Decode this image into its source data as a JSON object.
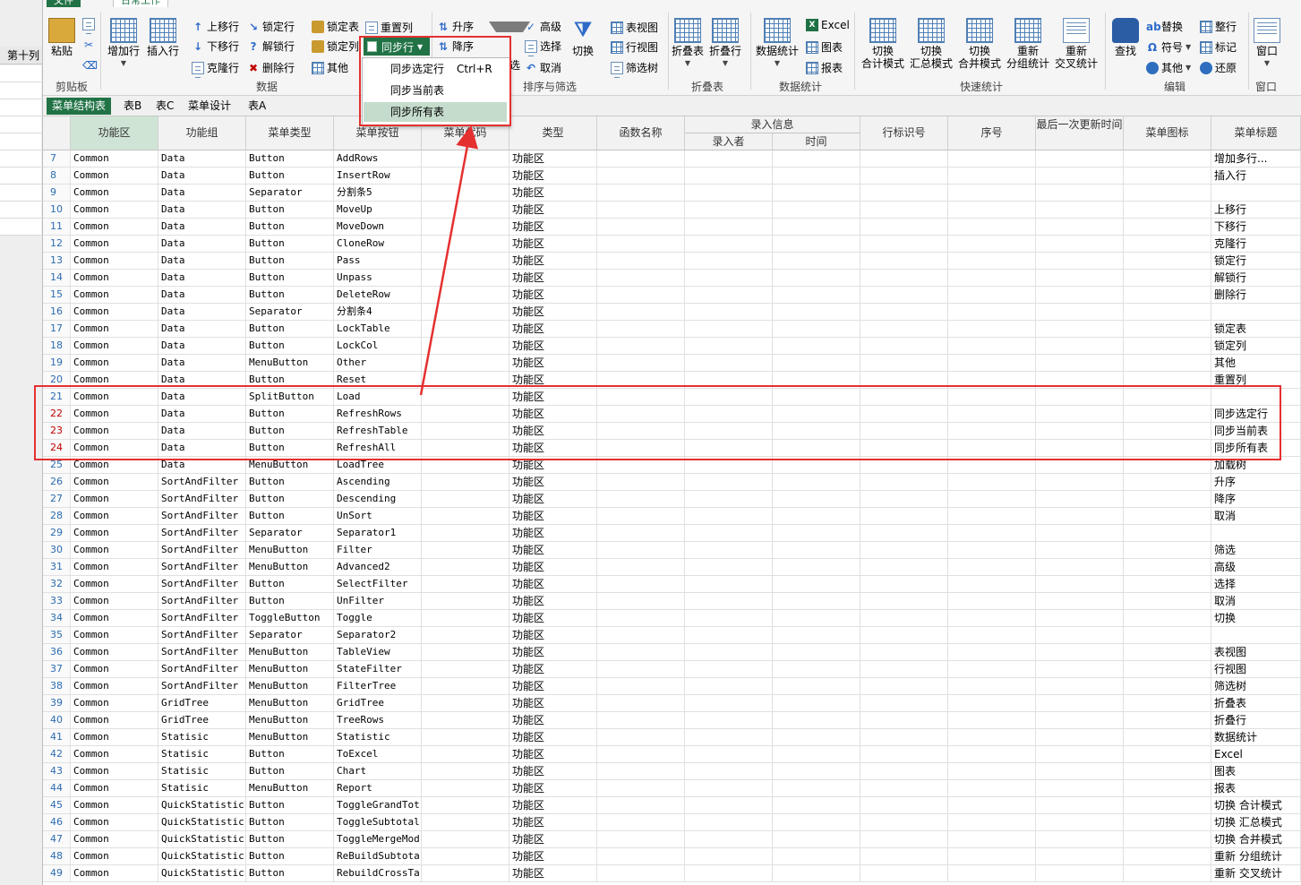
{
  "left_pane": {
    "col_header": "第十列"
  },
  "ribbon": {
    "tabs": [
      "文件",
      "日常工作",
      "",
      "",
      "",
      ""
    ],
    "groups": {
      "clipboard": {
        "label": "剪贴板",
        "paste": "粘贴"
      },
      "data": {
        "label": "数据",
        "add_row": "增加行",
        "insert_row": "插入行",
        "move_up": "上移行",
        "move_down": "下移行",
        "clone_row": "克隆行",
        "lock_row": "锁定行",
        "unlock_row": "解锁行",
        "delete_row": "删除行",
        "lock_table": "锁定表",
        "lock_col": "锁定列",
        "other": "其他",
        "reset_col": "重置列",
        "sync_row": "同步行"
      },
      "sort_filter": {
        "label": "排序与筛选",
        "asc": "升序",
        "desc": "降序",
        "filter": "筛选",
        "advanced": "高级",
        "select": "选择",
        "cancel": "取消",
        "toggle": "切换"
      },
      "view": {
        "table_view": "表视图",
        "row_view": "行视图",
        "filter_tree": "筛选树"
      },
      "fold": {
        "label": "折叠表",
        "fold_table": "折叠表",
        "fold_row": "折叠行"
      },
      "stats": {
        "label": "数据统计",
        "data_stats": "数据统计",
        "excel": "Excel",
        "chart": "图表",
        "report": "报表"
      },
      "quick": {
        "label": "快速统计",
        "items": [
          [
            "切换",
            "合计模式"
          ],
          [
            "切换",
            "汇总模式"
          ],
          [
            "切换",
            "合并模式"
          ],
          [
            "重新",
            "分组统计"
          ],
          [
            "重新",
            "交叉统计"
          ]
        ]
      },
      "edit": {
        "label": "编辑",
        "find": "查找",
        "replace": "替换",
        "symbol": "符号",
        "other": "其他",
        "tidy": "整行",
        "mark": "标记",
        "restore": "还原"
      },
      "window": {
        "label": "窗口",
        "window": "窗口"
      }
    }
  },
  "dropdown": {
    "items": [
      {
        "label": "同步选定行",
        "shortcut": "Ctrl+R"
      },
      {
        "label": "同步当前表",
        "shortcut": ""
      },
      {
        "label": "同步所有表",
        "shortcut": ""
      }
    ]
  },
  "sheet_tabs": [
    "菜单结构表",
    "表B",
    "表C",
    "菜单设计",
    "表A"
  ],
  "grid": {
    "headers": [
      "功能区",
      "功能组",
      "菜单类型",
      "菜单按钮",
      "菜单代码",
      "类型",
      "函数名称",
      "录入信息",
      "行标识号",
      "序号",
      "最后一次更新时间",
      "菜单图标",
      "菜单标题"
    ],
    "subheaders": [
      "录入者",
      "时间"
    ],
    "rows": [
      {
        "n": "7",
        "area": "Common",
        "group": "Data",
        "type": "Button",
        "btn": "AddRows",
        "kind": "功能区",
        "title": "增加多行..."
      },
      {
        "n": "8",
        "area": "Common",
        "group": "Data",
        "type": "Button",
        "btn": "InsertRow",
        "kind": "功能区",
        "title": "插入行"
      },
      {
        "n": "9",
        "area": "Common",
        "group": "Data",
        "type": "Separator",
        "btn": "分割条5",
        "kind": "功能区",
        "title": ""
      },
      {
        "n": "10",
        "area": "Common",
        "group": "Data",
        "type": "Button",
        "btn": "MoveUp",
        "kind": "功能区",
        "title": "上移行"
      },
      {
        "n": "11",
        "area": "Common",
        "group": "Data",
        "type": "Button",
        "btn": "MoveDown",
        "kind": "功能区",
        "title": "下移行"
      },
      {
        "n": "12",
        "area": "Common",
        "group": "Data",
        "type": "Button",
        "btn": "CloneRow",
        "kind": "功能区",
        "title": "克隆行"
      },
      {
        "n": "13",
        "area": "Common",
        "group": "Data",
        "type": "Button",
        "btn": "Pass",
        "kind": "功能区",
        "title": "锁定行"
      },
      {
        "n": "14",
        "area": "Common",
        "group": "Data",
        "type": "Button",
        "btn": "Unpass",
        "kind": "功能区",
        "title": "解锁行"
      },
      {
        "n": "15",
        "area": "Common",
        "group": "Data",
        "type": "Button",
        "btn": "DeleteRow",
        "kind": "功能区",
        "title": "删除行"
      },
      {
        "n": "16",
        "area": "Common",
        "group": "Data",
        "type": "Separator",
        "btn": "分割条4",
        "kind": "功能区",
        "title": ""
      },
      {
        "n": "17",
        "area": "Common",
        "group": "Data",
        "type": "Button",
        "btn": "LockTable",
        "kind": "功能区",
        "title": "锁定表"
      },
      {
        "n": "18",
        "area": "Common",
        "group": "Data",
        "type": "Button",
        "btn": "LockCol",
        "kind": "功能区",
        "title": "锁定列"
      },
      {
        "n": "19",
        "area": "Common",
        "group": "Data",
        "type": "MenuButton",
        "btn": "Other",
        "kind": "功能区",
        "title": "其他"
      },
      {
        "n": "20",
        "area": "Common",
        "group": "Data",
        "type": "Button",
        "btn": "Reset",
        "kind": "功能区",
        "title": "重置列"
      },
      {
        "n": "21",
        "area": "Common",
        "group": "Data",
        "type": "SplitButton",
        "btn": "Load",
        "kind": "功能区",
        "title": ""
      },
      {
        "n": "22",
        "area": "Common",
        "group": "Data",
        "type": "Button",
        "btn": "RefreshRows",
        "kind": "功能区",
        "title": "同步选定行",
        "red": true
      },
      {
        "n": "23",
        "area": "Common",
        "group": "Data",
        "type": "Button",
        "btn": "RefreshTable",
        "kind": "功能区",
        "title": "同步当前表",
        "red": true
      },
      {
        "n": "24",
        "area": "Common",
        "group": "Data",
        "type": "Button",
        "btn": "RefreshAll",
        "kind": "功能区",
        "title": "同步所有表",
        "red": true
      },
      {
        "n": "25",
        "area": "Common",
        "group": "Data",
        "type": "MenuButton",
        "btn": "LoadTree",
        "kind": "功能区",
        "title": "加载树"
      },
      {
        "n": "26",
        "area": "Common",
        "group": "SortAndFilter",
        "type": "Button",
        "btn": "Ascending",
        "kind": "功能区",
        "title": "升序"
      },
      {
        "n": "27",
        "area": "Common",
        "group": "SortAndFilter",
        "type": "Button",
        "btn": "Descending",
        "kind": "功能区",
        "title": "降序"
      },
      {
        "n": "28",
        "area": "Common",
        "group": "SortAndFilter",
        "type": "Button",
        "btn": "UnSort",
        "kind": "功能区",
        "title": "取消"
      },
      {
        "n": "29",
        "area": "Common",
        "group": "SortAndFilter",
        "type": "Separator",
        "btn": "Separator1",
        "kind": "功能区",
        "title": ""
      },
      {
        "n": "30",
        "area": "Common",
        "group": "SortAndFilter",
        "type": "MenuButton",
        "btn": "Filter",
        "kind": "功能区",
        "title": "筛选"
      },
      {
        "n": "31",
        "area": "Common",
        "group": "SortAndFilter",
        "type": "MenuButton",
        "btn": "Advanced2",
        "kind": "功能区",
        "title": "高级"
      },
      {
        "n": "32",
        "area": "Common",
        "group": "SortAndFilter",
        "type": "Button",
        "btn": "SelectFilter",
        "kind": "功能区",
        "title": "选择"
      },
      {
        "n": "33",
        "area": "Common",
        "group": "SortAndFilter",
        "type": "Button",
        "btn": "UnFilter",
        "kind": "功能区",
        "title": "取消"
      },
      {
        "n": "34",
        "area": "Common",
        "group": "SortAndFilter",
        "type": "ToggleButton",
        "btn": "Toggle",
        "kind": "功能区",
        "title": "切换"
      },
      {
        "n": "35",
        "area": "Common",
        "group": "SortAndFilter",
        "type": "Separator",
        "btn": "Separator2",
        "kind": "功能区",
        "title": ""
      },
      {
        "n": "36",
        "area": "Common",
        "group": "SortAndFilter",
        "type": "MenuButton",
        "btn": "TableView",
        "kind": "功能区",
        "title": "表视图"
      },
      {
        "n": "37",
        "area": "Common",
        "group": "SortAndFilter",
        "type": "MenuButton",
        "btn": "StateFilter",
        "kind": "功能区",
        "title": "行视图"
      },
      {
        "n": "38",
        "area": "Common",
        "group": "SortAndFilter",
        "type": "MenuButton",
        "btn": "FilterTree",
        "kind": "功能区",
        "title": "筛选树"
      },
      {
        "n": "39",
        "area": "Common",
        "group": "GridTree",
        "type": "MenuButton",
        "btn": "GridTree",
        "kind": "功能区",
        "title": "折叠表"
      },
      {
        "n": "40",
        "area": "Common",
        "group": "GridTree",
        "type": "MenuButton",
        "btn": "TreeRows",
        "kind": "功能区",
        "title": "折叠行"
      },
      {
        "n": "41",
        "area": "Common",
        "group": "Statisic",
        "type": "MenuButton",
        "btn": "Statistic",
        "kind": "功能区",
        "title": "数据统计"
      },
      {
        "n": "42",
        "area": "Common",
        "group": "Statisic",
        "type": "Button",
        "btn": "ToExcel",
        "kind": "功能区",
        "title": "Excel"
      },
      {
        "n": "43",
        "area": "Common",
        "group": "Statisic",
        "type": "Button",
        "btn": "Chart",
        "kind": "功能区",
        "title": "图表"
      },
      {
        "n": "44",
        "area": "Common",
        "group": "Statisic",
        "type": "MenuButton",
        "btn": "Report",
        "kind": "功能区",
        "title": "报表"
      },
      {
        "n": "45",
        "area": "Common",
        "group": "QuickStatistic",
        "type": "Button",
        "btn": "ToggleGrandTot",
        "kind": "功能区",
        "title": "切换 合计模式"
      },
      {
        "n": "46",
        "area": "Common",
        "group": "QuickStatistic",
        "type": "Button",
        "btn": "ToggleSubtotal",
        "kind": "功能区",
        "title": "切换 汇总模式"
      },
      {
        "n": "47",
        "area": "Common",
        "group": "QuickStatistic",
        "type": "Button",
        "btn": "ToggleMergeMod",
        "kind": "功能区",
        "title": "切换 合并模式"
      },
      {
        "n": "48",
        "area": "Common",
        "group": "QuickStatistic",
        "type": "Button",
        "btn": "ReBuildSubtota",
        "kind": "功能区",
        "title": "重新 分组统计"
      },
      {
        "n": "49",
        "area": "Common",
        "group": "QuickStatistic",
        "type": "Button",
        "btn": "RebuildCrossTa",
        "kind": "功能区",
        "title": "重新 交叉统计"
      }
    ]
  },
  "colors": {
    "accent": "#217346",
    "annotation": "#e53030",
    "row_number": "#2c6cb0",
    "row_number_highlight": "#c00000"
  }
}
